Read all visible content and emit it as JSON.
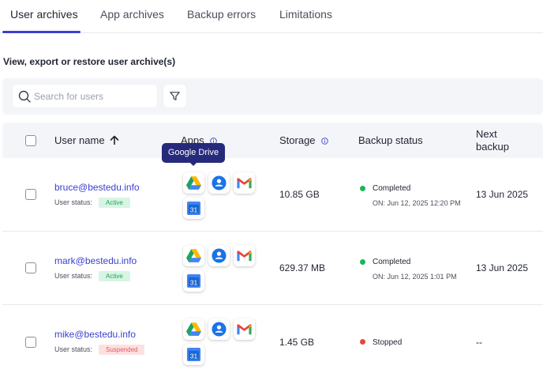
{
  "tabs": [
    {
      "label": "User archives",
      "active": true
    },
    {
      "label": "App archives",
      "active": false
    },
    {
      "label": "Backup errors",
      "active": false
    },
    {
      "label": "Limitations",
      "active": false
    }
  ],
  "subtitle": "View, export or restore user archive(s)",
  "search": {
    "placeholder": "Search for users",
    "value": ""
  },
  "table": {
    "headers": {
      "user_name": "User name",
      "apps": "Apps",
      "storage": "Storage",
      "backup_status": "Backup status",
      "next_backup_line1": "Next",
      "next_backup_line2": "backup"
    },
    "sort": {
      "column": "user_name",
      "direction": "ascending"
    },
    "rows": [
      {
        "email": "bruce@bestedu.info",
        "user_status_label": "User status:",
        "user_status": "Active",
        "apps": [
          "google-drive",
          "google-contacts",
          "gmail",
          "google-calendar"
        ],
        "storage": "10.85 GB",
        "backup_status": "Completed",
        "backup_date": "ON:  Jun 12, 2025 12:20 PM",
        "next_backup": "13 Jun 2025"
      },
      {
        "email": "mark@bestedu.info",
        "user_status_label": "User status:",
        "user_status": "Active",
        "apps": [
          "google-drive",
          "google-contacts",
          "gmail",
          "google-calendar"
        ],
        "storage": "629.37 MB",
        "backup_status": "Completed",
        "backup_date": "ON:  Jun 12, 2025 1:01 PM",
        "next_backup": "13 Jun 2025"
      },
      {
        "email": "mike@bestedu.info",
        "user_status_label": "User status:",
        "user_status": "Suspended",
        "apps": [
          "google-drive",
          "google-contacts",
          "gmail",
          "google-calendar"
        ],
        "storage": "1.45 GB",
        "backup_status": "Stopped",
        "backup_date": "",
        "next_backup": "--"
      }
    ]
  },
  "tooltip": "Google Drive",
  "calendar_icon_text": "31",
  "colors": {
    "accent": "#3b3fd1",
    "completed": "#1db45a",
    "stopped": "#e5483c",
    "tooltip_bg": "#262a7a"
  }
}
